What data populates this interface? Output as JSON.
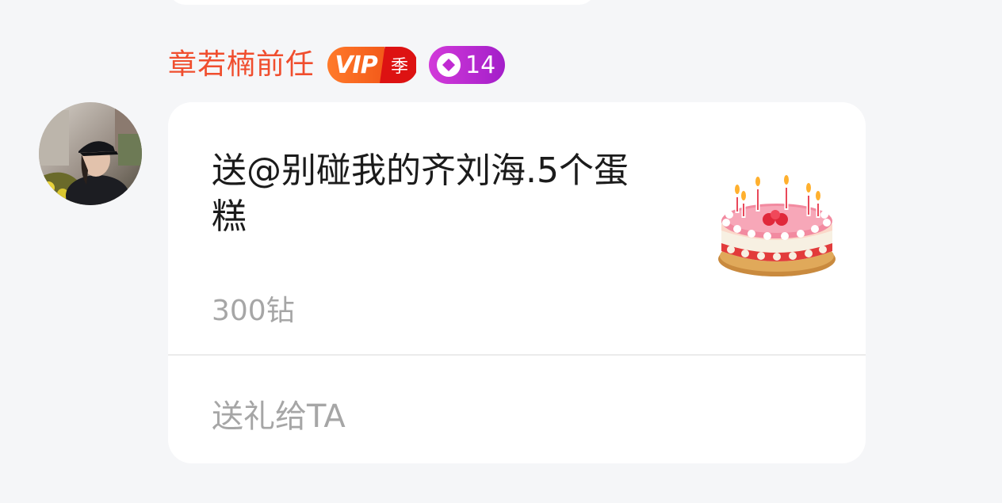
{
  "message": {
    "sender_name": "章若楠前任",
    "vip_badge": {
      "label": "VIP",
      "tier": "季"
    },
    "level_badge": {
      "level": "14"
    },
    "gift": {
      "text": "送@别碰我的齐刘海.5个蛋糕",
      "price": "300钻",
      "icon": "cake-icon",
      "action_label": "送礼给TA"
    }
  },
  "colors": {
    "sender_name": "#f04e2e",
    "vip_orange": "#f35a1a",
    "vip_red": "#dd1212",
    "level_purple": "#b828cf",
    "secondary_text": "#a6a6a6",
    "page_bg": "#f5f6f8"
  }
}
